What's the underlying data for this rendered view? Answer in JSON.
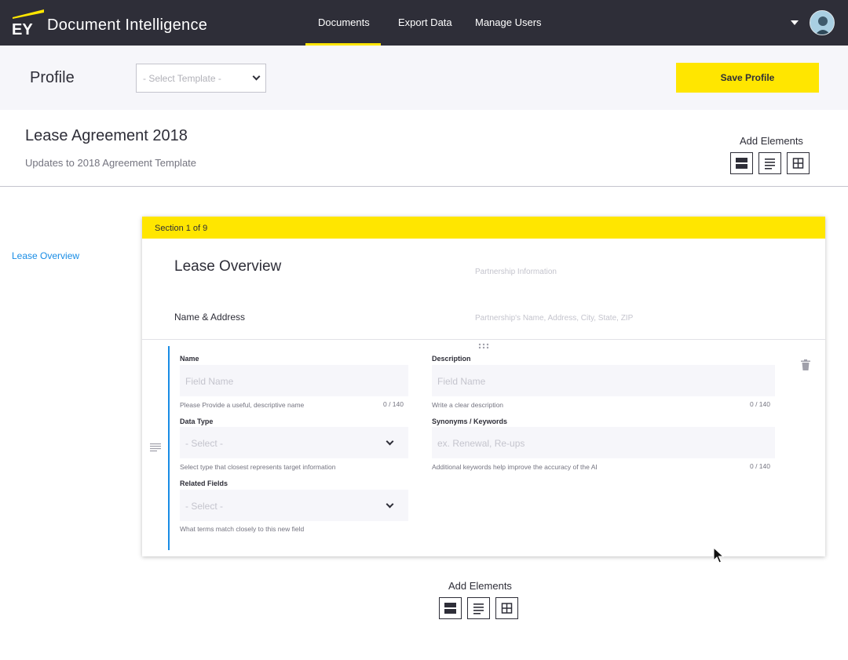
{
  "app": {
    "brand": "EY",
    "title": "Document Intelligence",
    "nav": [
      "Documents",
      "Export Data",
      "Manage Users"
    ],
    "active_nav": "Documents"
  },
  "profile": {
    "title": "Profile",
    "template_placeholder": "- Select Template -",
    "save_label": "Save Profile"
  },
  "document": {
    "title": "Lease Agreement 2018",
    "subtitle": "Updates to 2018 Agreement Template",
    "add_elements_label": "Add Elements"
  },
  "sidebar": {
    "items": [
      {
        "label": "Lease Overview"
      }
    ]
  },
  "section": {
    "counter": "Section 1 of 9",
    "title": "Lease Overview",
    "title_placeholder": "Partnership Information",
    "subsection_title": "Name & Address",
    "subsection_placeholder": "Partnership's Name, Address, City, State, ZIP"
  },
  "fields": {
    "name": {
      "label": "Name",
      "placeholder": "Field Name",
      "help": "Please Provide a useful, descriptive name",
      "count": "0 / 140"
    },
    "description": {
      "label": "Description",
      "placeholder": "Field Name",
      "help": "Write a clear description",
      "count": "0 / 140"
    },
    "data_type": {
      "label": "Data Type",
      "placeholder": "- Select -",
      "help": "Select type that closest represents target information"
    },
    "synonyms": {
      "label": "Synonyms / Keywords",
      "placeholder": "ex. Renewal, Re-ups",
      "help": "Additional keywords help improve the accuracy of the AI",
      "count": "0 / 140"
    },
    "related": {
      "label": "Related Fields",
      "placeholder": "- Select -",
      "help": "What terms match closely to this new field"
    }
  },
  "bottom": {
    "add_elements_label": "Add Elements"
  },
  "colors": {
    "accent": "#ffe600",
    "dark": "#2e2e38",
    "link": "#188ce5",
    "band": "#f6f6fa"
  },
  "icons": [
    "ey-logo",
    "caret-down-icon",
    "avatar",
    "chevron-down-icon",
    "section-element-icon",
    "text-element-icon",
    "grid-element-icon",
    "drag-handle-icon",
    "reorder-lines-icon",
    "trash-icon",
    "cursor-icon"
  ]
}
